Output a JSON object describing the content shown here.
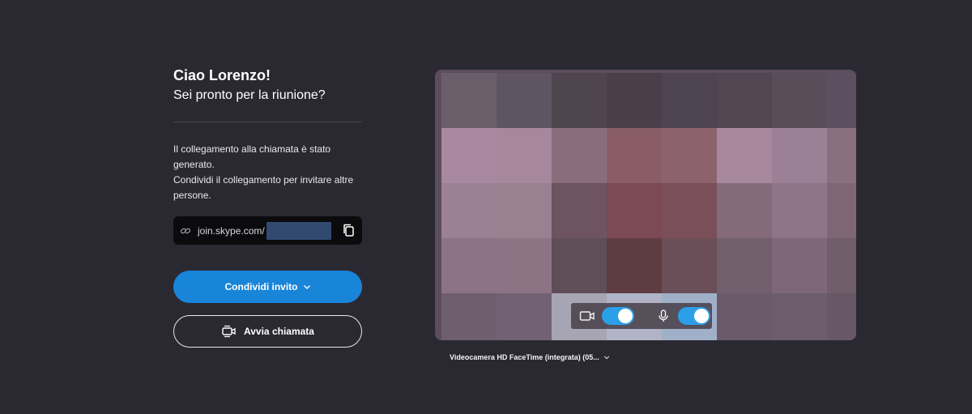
{
  "greeting": {
    "title": "Ciao Lorenzo!",
    "subtitle": "Sei pronto per la riunione?"
  },
  "info": {
    "line1": "Il collegamento alla chiamata è stato generato.",
    "line2": "Condividi il collegamento per invitare altre persone."
  },
  "link": {
    "prefix": "join.skype.com/",
    "icon": "link-icon",
    "copy_icon": "copy-icon"
  },
  "buttons": {
    "share_invite": "Condividi invito",
    "start_call": "Avvia chiamata"
  },
  "camera": {
    "device_label": "Videocamera HD FaceTime (integrata) (05...",
    "video_toggle_on": true,
    "mic_toggle_on": true
  },
  "colors": {
    "background": "#2a2931",
    "accent": "#1985d9",
    "toggle": "#2b9fe8"
  }
}
